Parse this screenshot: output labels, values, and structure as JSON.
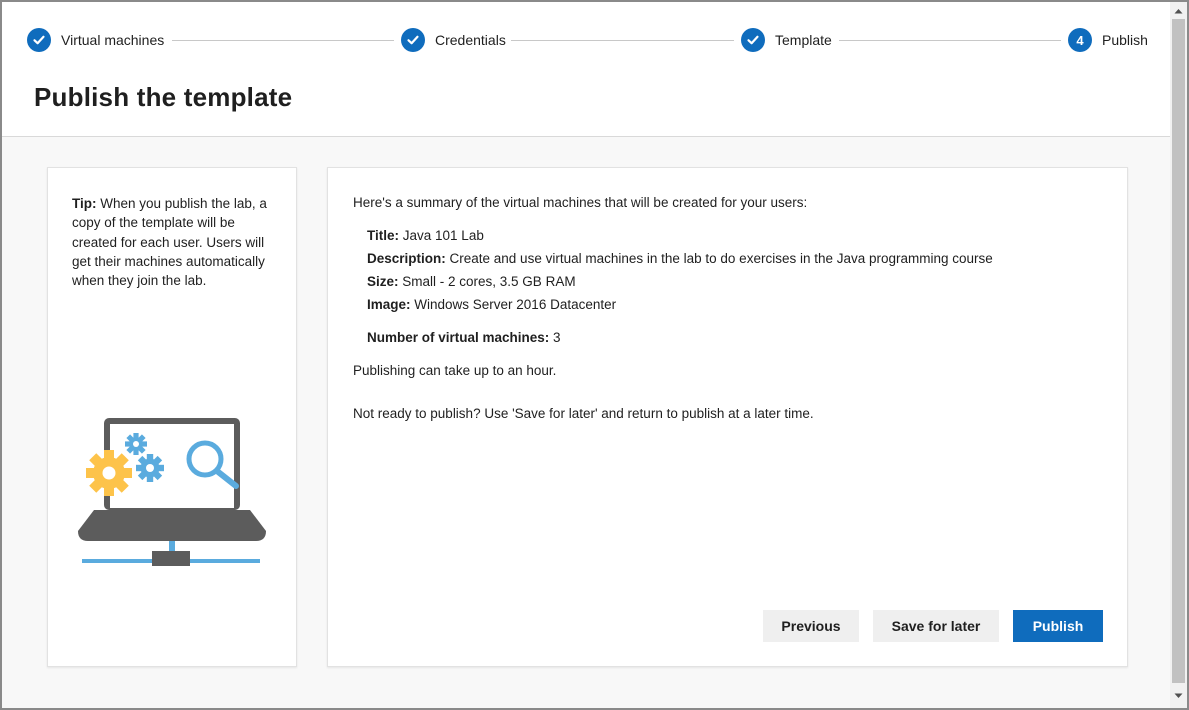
{
  "stepper": {
    "steps": [
      {
        "label": "Virtual machines",
        "state": "complete",
        "marker": "✓"
      },
      {
        "label": "Credentials",
        "state": "complete",
        "marker": "✓"
      },
      {
        "label": "Template",
        "state": "complete",
        "marker": "✓"
      },
      {
        "label": "Publish",
        "state": "current",
        "marker": "4"
      }
    ]
  },
  "page_title": "Publish the template",
  "tip": {
    "prefix": "Tip:",
    "text": " When you publish the lab, a copy of the template will be created for each user. Users will get their machines automatically when they join the lab."
  },
  "summary": {
    "intro": "Here's a summary of the virtual machines that will be created for your users:",
    "title_label": "Title:",
    "title_value": " Java 101 Lab",
    "description_label": "Description:",
    "description_value": " Create and use virtual machines in the lab to do exercises in the Java programming course",
    "size_label": "Size:",
    "size_value": " Small - 2 cores, 3.5 GB RAM",
    "image_label": "Image:",
    "image_value": " Windows Server 2016 Datacenter",
    "count_label": "Number of virtual machines:",
    "count_value": " 3",
    "note_time": "Publishing can take up to an hour.",
    "note_later": "Not ready to publish? Use 'Save for later' and return to publish at a later time."
  },
  "buttons": {
    "previous": "Previous",
    "save_for_later": "Save for later",
    "publish": "Publish"
  },
  "colors": {
    "accent": "#0f6cbd",
    "gear_yellow": "#fdc34a",
    "illustration_blue": "#5aabde",
    "laptop_gray": "#5c5c5c"
  },
  "icons": {
    "step_complete": "checkmark-icon",
    "illustration": "laptop-gears-search-illustration",
    "scroll_up": "chevron-up-icon",
    "scroll_down": "chevron-down-icon"
  }
}
